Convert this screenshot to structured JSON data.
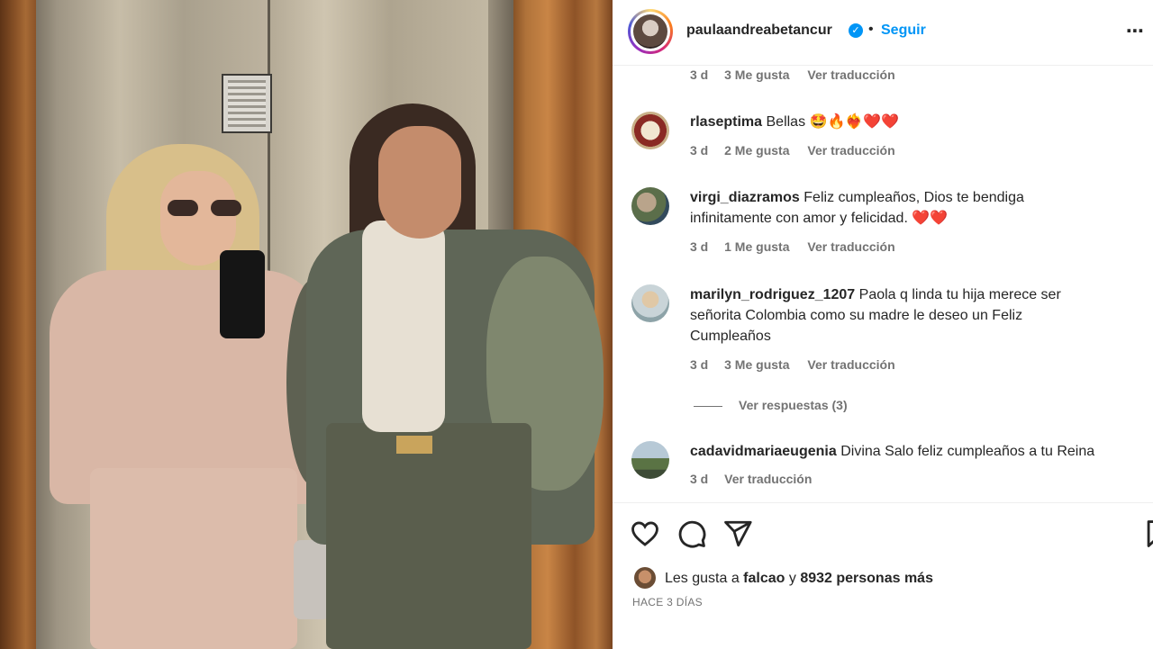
{
  "post": {
    "image_alt": "Two women posing in front of elevator doors, taking a mirror selfie"
  },
  "header": {
    "username": "paulaandreabetancur",
    "verified_icon": "verified-badge-icon",
    "separator": "•",
    "follow_label": "Seguir",
    "more_icon": "more-options-icon"
  },
  "comments": [
    {
      "username": "",
      "text": "",
      "age": "3 d",
      "likes": "3 Me gusta",
      "translate": "Ver traducción"
    },
    {
      "username": "rlaseptima",
      "text": "Bellas 🤩🔥❤️‍🔥❤️❤️",
      "age": "3 d",
      "likes": "2 Me gusta",
      "translate": "Ver traducción"
    },
    {
      "username": "virgi_diazramos",
      "text": "Feliz cumpleaños, Dios te bendiga infinitamente con amor y felicidad.",
      "hearts": "❤️❤️",
      "age": "3 d",
      "likes": "1 Me gusta",
      "translate": "Ver traducción"
    },
    {
      "username": "marilyn_rodriguez_1207",
      "text": "Paola q linda tu hija merece ser señorita Colombia como su madre le deseo un Feliz Cumpleaños",
      "age": "3 d",
      "likes": "3 Me gusta",
      "translate": "Ver traducción",
      "replies": "Ver respuestas (3)"
    },
    {
      "username": "cadavidmariaeugenia",
      "text": "Divina Salo feliz cumpleaños a tu Reina",
      "age": "3 d",
      "translate": "Ver traducción"
    }
  ],
  "actions": {
    "like_icon": "heart-icon",
    "comment_icon": "comment-icon",
    "share_icon": "share-icon",
    "save_icon": "bookmark-icon"
  },
  "likes": {
    "prefix": "Les gusta a ",
    "user": "falcao",
    "middle": " y ",
    "count": "8932 personas más"
  },
  "date": "HACE 3 DÍAS",
  "colors": {
    "link_blue": "#0095f6",
    "secondary_text": "#737373",
    "heart_red": "#ed2a3a"
  }
}
